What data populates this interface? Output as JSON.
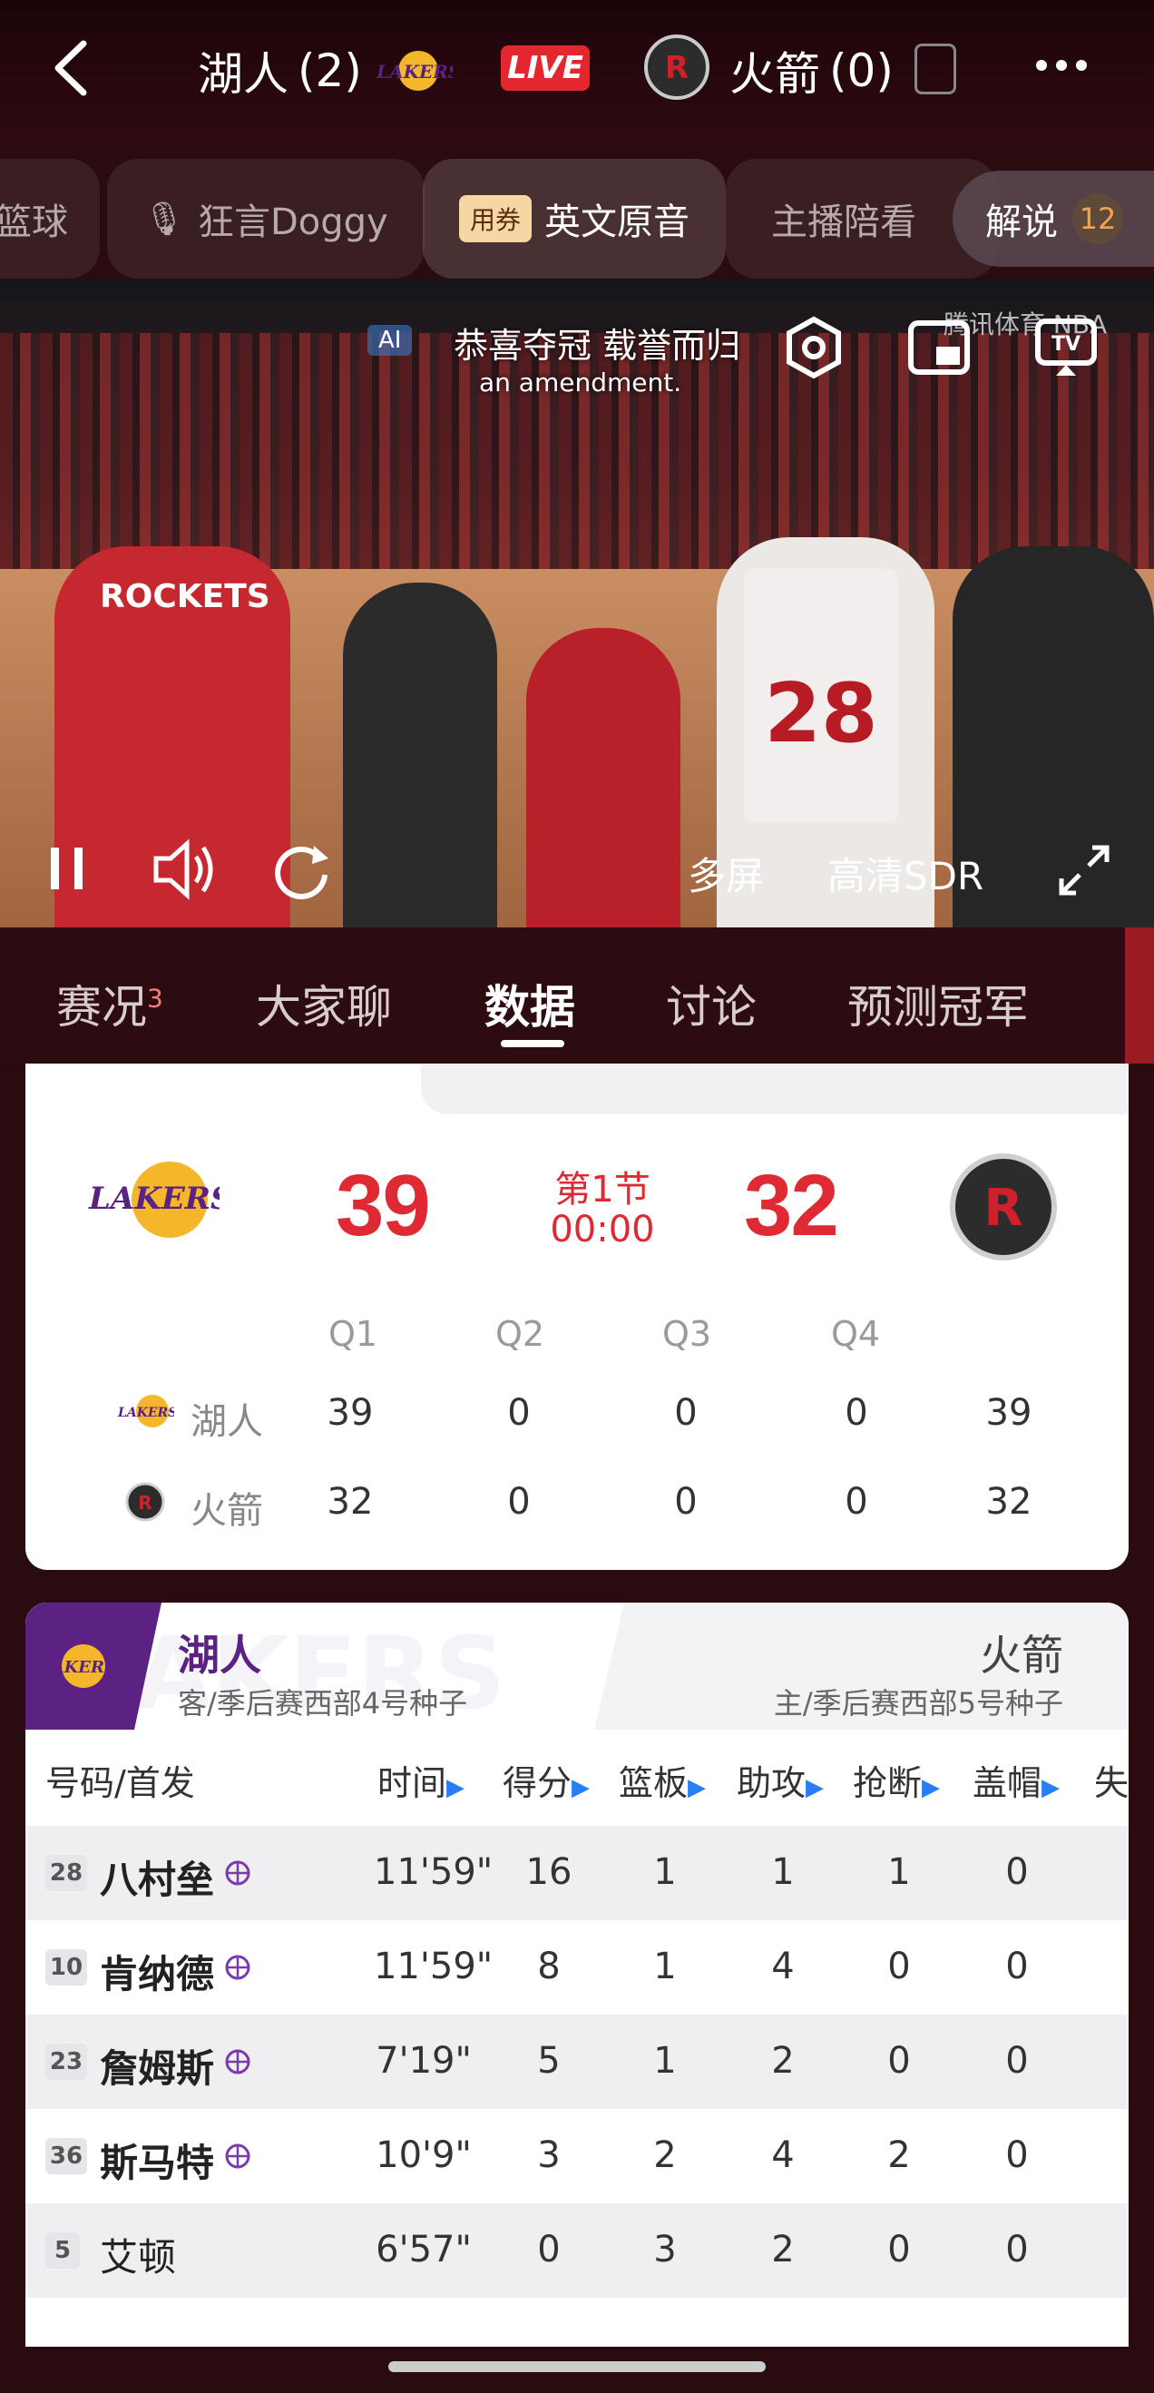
{
  "header": {
    "away_team": "湖人",
    "away_wins": "(2)",
    "home_team": "火箭",
    "home_wins": "(0)",
    "live_label": "LIVE"
  },
  "channels": [
    {
      "label": "篮球"
    },
    {
      "label": "狂言Doggy"
    },
    {
      "label": "英文原音",
      "badge": "用券"
    },
    {
      "label": "主播陪看"
    }
  ],
  "commentary": {
    "label": "解说",
    "count": "12"
  },
  "video": {
    "subtitle_cn": "恭喜夺冠 载誉而归",
    "subtitle_en": "an amendment.",
    "ai_label": "AI",
    "watermark": "腾讯体育 NBA",
    "multi_screen": "多屏",
    "quality": "高清SDR"
  },
  "section_tabs": [
    {
      "label": "赛况",
      "sup": "3"
    },
    {
      "label": "大家聊"
    },
    {
      "label": "数据",
      "active": true
    },
    {
      "label": "讨论"
    },
    {
      "label": "预测冠军"
    }
  ],
  "scoreboard": {
    "away_score": "39",
    "home_score": "32",
    "period": "第1节",
    "clock": "00:00",
    "quarters": [
      "Q1",
      "Q2",
      "Q3",
      "Q4"
    ],
    "rows": [
      {
        "team": "湖人",
        "values": [
          "39",
          "0",
          "0",
          "0",
          "39"
        ]
      },
      {
        "team": "火箭",
        "values": [
          "32",
          "0",
          "0",
          "0",
          "32"
        ]
      }
    ]
  },
  "stats": {
    "away_name": "湖人",
    "away_sub": "客/季后赛西部4号种子",
    "home_name": "火箭",
    "home_sub": "主/季后赛西部5号种子",
    "watermark": "AKERS",
    "columns": [
      "号码/首发",
      "时间",
      "得分",
      "篮板",
      "助攻",
      "抢断",
      "盖帽",
      "失"
    ],
    "players": [
      {
        "number": "28",
        "name": "八村垒",
        "starter": true,
        "time": "11'59\"",
        "pts": "16",
        "reb": "1",
        "ast": "1",
        "stl": "1",
        "blk": "0"
      },
      {
        "number": "10",
        "name": "肯纳德",
        "starter": true,
        "time": "11'59\"",
        "pts": "8",
        "reb": "1",
        "ast": "4",
        "stl": "0",
        "blk": "0"
      },
      {
        "number": "23",
        "name": "詹姆斯",
        "starter": true,
        "time": "7'19\"",
        "pts": "5",
        "reb": "1",
        "ast": "2",
        "stl": "0",
        "blk": "0"
      },
      {
        "number": "36",
        "name": "斯马特",
        "starter": true,
        "time": "10'9\"",
        "pts": "3",
        "reb": "2",
        "ast": "4",
        "stl": "2",
        "blk": "0"
      },
      {
        "number": "5",
        "name": "艾顿",
        "starter": false,
        "time": "6'57\"",
        "pts": "0",
        "reb": "3",
        "ast": "2",
        "stl": "0",
        "blk": "0"
      }
    ]
  },
  "colors": {
    "accent_red": "#e02a33",
    "lakers_purple": "#5b2183",
    "lakers_gold": "#f5b72a",
    "arrow_blue": "#2a7ef5"
  }
}
